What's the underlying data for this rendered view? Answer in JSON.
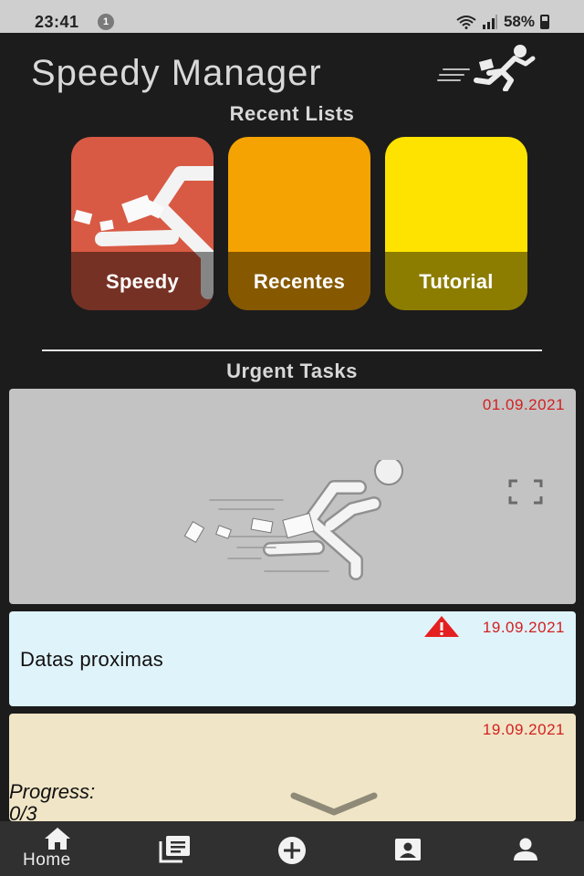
{
  "status_bar": {
    "time": "23:41",
    "notification_count": "1",
    "battery": "58%",
    "icons": [
      "wifi-icon",
      "signal-icon",
      "battery-icon"
    ]
  },
  "header": {
    "app_title": "Speedy Manager",
    "logo": "running-man-logo"
  },
  "recent_lists": {
    "title": "Recent Lists",
    "cards": [
      {
        "label": "Speedy",
        "color": "#d85a44"
      },
      {
        "label": "Recentes",
        "color": "#f5a302"
      },
      {
        "label": "Tutorial",
        "color": "#ffe300"
      }
    ]
  },
  "urgent_tasks": {
    "title": "Urgent Tasks",
    "tasks": [
      {
        "date": "01.09.2021",
        "background": "#c3c3c3",
        "icon": "expand-icon"
      },
      {
        "date": "19.09.2021",
        "title": "Datas proximas",
        "background": "#dff3fa",
        "icon": "warning-icon"
      },
      {
        "date": "19.09.2021",
        "progress_label": "Progress:",
        "progress_value": "0/3",
        "background": "#f0e5c6"
      }
    ]
  },
  "bottom_nav": {
    "home_label": "Home",
    "items": [
      "home-icon",
      "lists-icon",
      "add-icon",
      "contacts-icon",
      "profile-icon"
    ]
  },
  "colors": {
    "background": "#1c1c1c",
    "date_red": "#d32020",
    "nav_bg": "#303030"
  }
}
